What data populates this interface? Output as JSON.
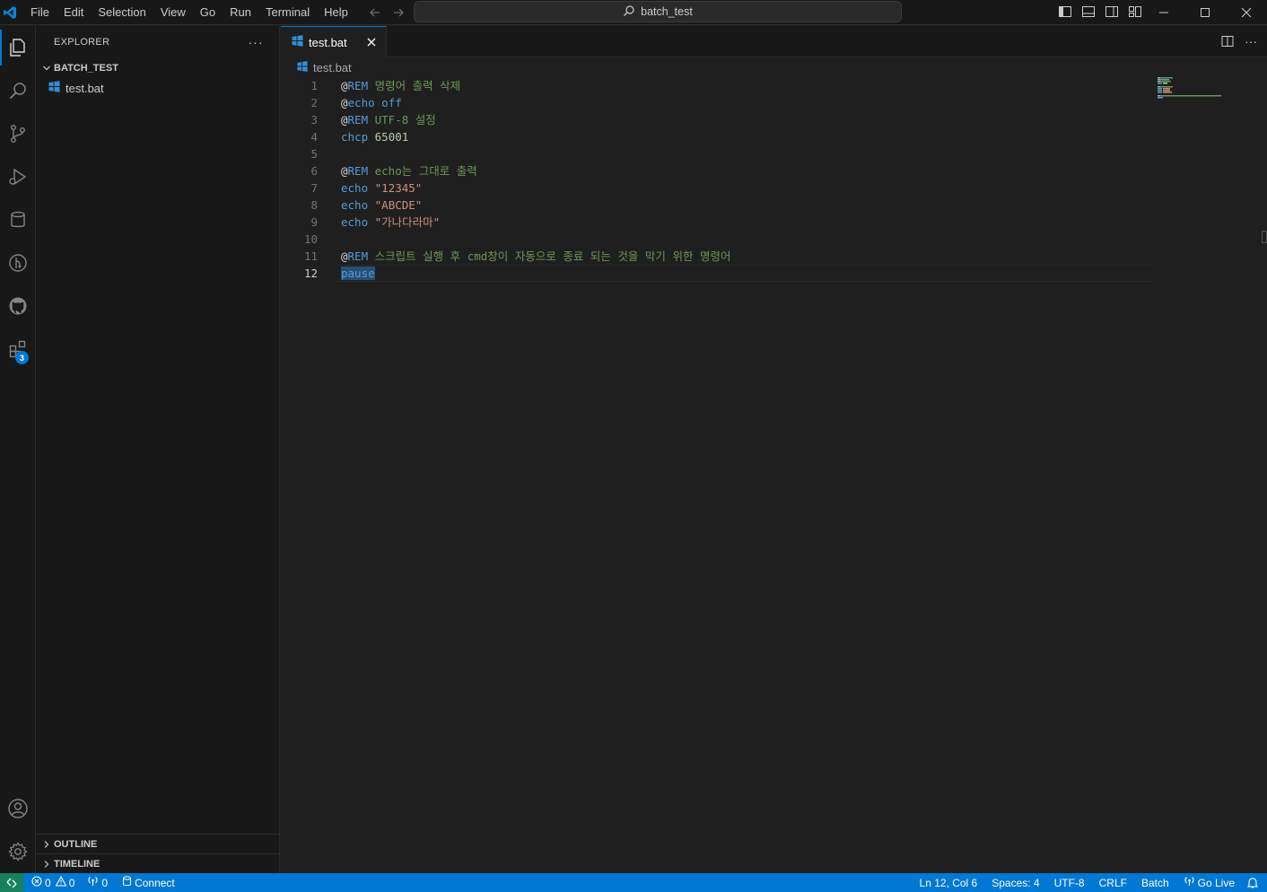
{
  "titlebar": {
    "menu": [
      "File",
      "Edit",
      "Selection",
      "View",
      "Go",
      "Run",
      "Terminal",
      "Help"
    ],
    "search_text": "batch_test"
  },
  "activity_bar": {
    "items": [
      "explorer-icon",
      "search-icon",
      "source-control-icon",
      "run-debug-icon",
      "database-icon",
      "git-graph-icon",
      "github-icon",
      "extensions-icon"
    ],
    "extensions_badge": "3",
    "bottom": [
      "account-icon",
      "settings-gear-icon"
    ]
  },
  "sidebar": {
    "title": "EXPLORER",
    "folder": "BATCH_TEST",
    "files": [
      "test.bat"
    ],
    "sections": [
      "OUTLINE",
      "TIMELINE"
    ]
  },
  "editor": {
    "tab_label": "test.bat",
    "breadcrumb": "test.bat",
    "line_numbers": [
      "1",
      "2",
      "3",
      "4",
      "5",
      "6",
      "7",
      "8",
      "9",
      "10",
      "11",
      "12"
    ],
    "lines": [
      [
        {
          "t": "@",
          "c": "at"
        },
        {
          "t": "REM",
          "c": "kw"
        },
        {
          "t": " 명령어 출력 삭제",
          "c": "cm"
        }
      ],
      [
        {
          "t": "@",
          "c": "at"
        },
        {
          "t": "echo",
          "c": "kw"
        },
        {
          "t": " ",
          "c": "plain"
        },
        {
          "t": "off",
          "c": "kw"
        }
      ],
      [
        {
          "t": "@",
          "c": "at"
        },
        {
          "t": "REM",
          "c": "kw"
        },
        {
          "t": " UTF-8 설정",
          "c": "cm"
        }
      ],
      [
        {
          "t": "chcp",
          "c": "kw"
        },
        {
          "t": " ",
          "c": "plain"
        },
        {
          "t": "65001",
          "c": "num"
        }
      ],
      [],
      [
        {
          "t": "@",
          "c": "at"
        },
        {
          "t": "REM",
          "c": "kw"
        },
        {
          "t": " echo는 그대로 출력",
          "c": "cm"
        }
      ],
      [
        {
          "t": "echo",
          "c": "kw"
        },
        {
          "t": " ",
          "c": "plain"
        },
        {
          "t": "\"12345\"",
          "c": "str"
        }
      ],
      [
        {
          "t": "echo",
          "c": "kw"
        },
        {
          "t": " ",
          "c": "plain"
        },
        {
          "t": "\"ABCDE\"",
          "c": "str"
        }
      ],
      [
        {
          "t": "echo",
          "c": "kw"
        },
        {
          "t": " ",
          "c": "plain"
        },
        {
          "t": "\"가나다라마\"",
          "c": "str"
        }
      ],
      [],
      [
        {
          "t": "@",
          "c": "at"
        },
        {
          "t": "REM",
          "c": "kw"
        },
        {
          "t": " 스크립트 실행 후 cmd창이 자동으로 종료 되는 것을 막기 위한 명령어",
          "c": "cm"
        }
      ],
      [
        {
          "t": "pause",
          "c": "kw sel"
        }
      ]
    ],
    "current_line": 12
  },
  "statusbar": {
    "errors": "0",
    "warnings": "0",
    "ports": "0",
    "connect": "Connect",
    "position": "Ln 12, Col 6",
    "spaces": "Spaces: 4",
    "encoding": "UTF-8",
    "eol": "CRLF",
    "language": "Batch",
    "golive": "Go Live"
  },
  "colors": {
    "accent": "#0078d4",
    "keyword": "#569cd6",
    "comment": "#6a9955",
    "string": "#ce9178",
    "number": "#b5cea8",
    "remote": "#16825d"
  }
}
